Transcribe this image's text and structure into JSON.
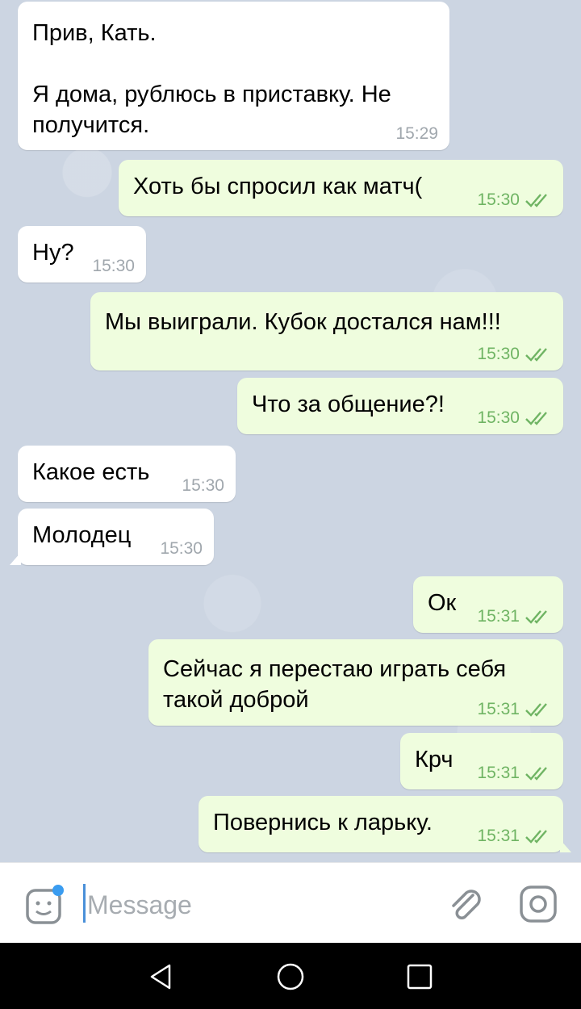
{
  "messages": [
    {
      "dir": "in",
      "text": "Прив, Кать.\n\nЯ дома, рублюсь в приставку. Не получится.",
      "time": "15:29"
    },
    {
      "dir": "out",
      "text": "Хоть бы спросил как матч(",
      "time": "15:30",
      "read": true
    },
    {
      "dir": "in",
      "text": "Ну?",
      "time": "15:30"
    },
    {
      "dir": "out",
      "text": "Мы выиграли. Кубок достался нам!!!",
      "time": "15:30",
      "read": true
    },
    {
      "dir": "out",
      "text": "Что за общение?!",
      "time": "15:30",
      "read": true
    },
    {
      "dir": "in",
      "text": "Какое есть",
      "time": "15:30"
    },
    {
      "dir": "in",
      "text": "Молодец",
      "time": "15:30"
    },
    {
      "dir": "out",
      "text": "Ок",
      "time": "15:31",
      "read": true
    },
    {
      "dir": "out",
      "text": "Сейчас я перестаю играть себя такой доброй",
      "time": "15:31",
      "read": true
    },
    {
      "dir": "out",
      "text": "Крч",
      "time": "15:31",
      "read": true
    },
    {
      "dir": "out",
      "text": "Повернись к ларьку.",
      "time": "15:31",
      "read": true
    }
  ],
  "input": {
    "placeholder": "Message",
    "value": "",
    "icons": {
      "left": "sticker-icon",
      "attach": "paperclip-icon",
      "camera": "camera-icon"
    }
  },
  "navbar": {
    "icons": [
      "back-icon",
      "home-icon",
      "recents-icon"
    ]
  },
  "colors": {
    "incoming": "#ffffff",
    "outgoing": "#effdde",
    "outgoing_meta": "#6fb463",
    "incoming_meta": "#a0a7ad",
    "accent": "#4a90d9"
  }
}
